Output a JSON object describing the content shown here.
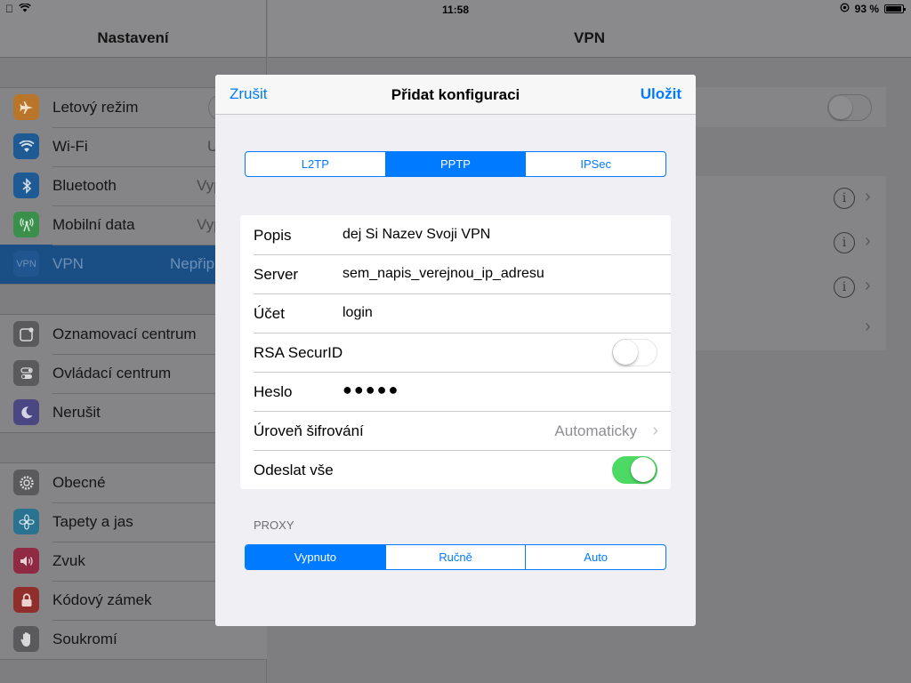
{
  "status": {
    "time": "11:58",
    "battery": "93 %",
    "battery_level": 0.93
  },
  "left": {
    "title": "Nastavení",
    "group1": [
      {
        "label": "Letový režim",
        "value": "",
        "icon": "airplane-icon",
        "color": "#ff9500"
      },
      {
        "label": "Wi-Fi",
        "value": "U",
        "icon": "wifi-icon",
        "color": "#007aff"
      },
      {
        "label": "Bluetooth",
        "value": "Vyp",
        "icon": "bluetooth-icon",
        "color": "#007aff"
      },
      {
        "label": "Mobilní data",
        "value": "Vyp",
        "icon": "antenna-icon",
        "color": "#4cd964"
      },
      {
        "label": "VPN",
        "value": "Nepřip",
        "icon": "vpn-icon",
        "color": "#1d62a7"
      }
    ],
    "group2": [
      {
        "label": "Oznamovací centrum",
        "icon": "notification-center-icon",
        "color": "#8e8e93"
      },
      {
        "label": "Ovládací centrum",
        "icon": "control-center-icon",
        "color": "#8e8e93"
      },
      {
        "label": "Nerušit",
        "icon": "moon-icon",
        "color": "#5856d6"
      }
    ],
    "group3": [
      {
        "label": "Obecné",
        "icon": "gear-icon",
        "color": "#8e8e93"
      },
      {
        "label": "Tapety a jas",
        "icon": "flower-icon",
        "color": "#34aadc"
      },
      {
        "label": "Zvuk",
        "icon": "speaker-icon",
        "color": "#ff2d55"
      },
      {
        "label": "Kódový zámek",
        "icon": "lock-icon",
        "color": "#ff3b30"
      },
      {
        "label": "Soukromí",
        "icon": "hand-icon",
        "color": "#8e8e93"
      }
    ]
  },
  "right": {
    "title": "VPN"
  },
  "modal": {
    "cancel": "Zrušit",
    "title": "Přidat konfiguraci",
    "save": "Uložit",
    "types": [
      "L2TP",
      "PPTP",
      "IPSec"
    ],
    "type_selected": "PPTP",
    "fields": {
      "popis_label": "Popis",
      "popis_value": "dej Si Nazev Svoji VPN",
      "server_label": "Server",
      "server_value": "sem_napis_verejnou_ip_adresu",
      "ucet_label": "Účet",
      "ucet_value": "login",
      "rsa_label": "RSA SecurID",
      "rsa_on": false,
      "heslo_label": "Heslo",
      "heslo_value": "●●●●●",
      "sifrovani_label": "Úroveň šifrování",
      "sifrovani_value": "Automaticky",
      "odeslat_label": "Odeslat vše",
      "odeslat_on": true
    },
    "proxy_label": "PROXY",
    "proxy_options": [
      "Vypnuto",
      "Ručně",
      "Auto"
    ],
    "proxy_selected": "Vypnuto"
  }
}
